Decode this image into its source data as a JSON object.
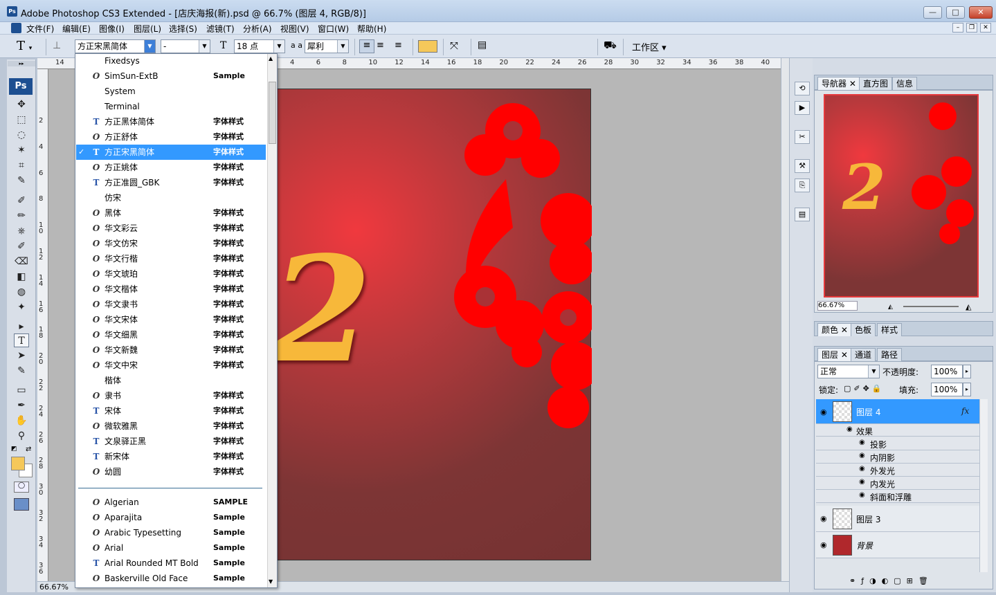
{
  "window": {
    "title": "Adobe Photoshop CS3 Extended - [店庆海报(新).psd @ 66.7% (图层 4, RGB/8)]",
    "min_glyph": "—",
    "max_glyph": "□",
    "close_glyph": "✕"
  },
  "menu": [
    "文件(F)",
    "编辑(E)",
    "图像(I)",
    "图层(L)",
    "选择(S)",
    "滤镜(T)",
    "分析(A)",
    "视图(V)",
    "窗口(W)",
    "帮助(H)"
  ],
  "options": {
    "font_family": "方正宋黑简体",
    "font_style": "-",
    "font_size": "18 点",
    "antialias_label": "a a",
    "antialias": "犀利",
    "workspace": "工作区",
    "text_color": "#f5c85a"
  },
  "font_list": {
    "items": [
      {
        "icon": "",
        "name": "Fixedsys",
        "sample": ""
      },
      {
        "icon": "O",
        "name": "SimSun-ExtB",
        "sample": "Sample"
      },
      {
        "icon": "",
        "name": "System",
        "sample": ""
      },
      {
        "icon": "",
        "name": "Terminal",
        "sample": ""
      },
      {
        "icon": "TT",
        "name": "方正黑体简体",
        "sample": "字体样式"
      },
      {
        "icon": "O",
        "name": "方正舒体",
        "sample": "字体样式"
      },
      {
        "icon": "TT",
        "name": "方正宋黑简体",
        "sample": "字体样式",
        "selected": true
      },
      {
        "icon": "O",
        "name": "方正姚体",
        "sample": "字体样式"
      },
      {
        "icon": "TT",
        "name": "方正准圆_GBK",
        "sample": "字体样式"
      },
      {
        "icon": "",
        "name": "仿宋",
        "sample": ""
      },
      {
        "icon": "O",
        "name": "黑体",
        "sample": "字体样式"
      },
      {
        "icon": "O",
        "name": "华文彩云",
        "sample": "字体样式"
      },
      {
        "icon": "O",
        "name": "华文仿宋",
        "sample": "字体样式"
      },
      {
        "icon": "O",
        "name": "华文行楷",
        "sample": "字体样式"
      },
      {
        "icon": "O",
        "name": "华文琥珀",
        "sample": "字体样式"
      },
      {
        "icon": "O",
        "name": "华文楷体",
        "sample": "字体样式"
      },
      {
        "icon": "O",
        "name": "华文隶书",
        "sample": "字体样式"
      },
      {
        "icon": "O",
        "name": "华文宋体",
        "sample": "字体样式"
      },
      {
        "icon": "O",
        "name": "华文细黑",
        "sample": "字体样式"
      },
      {
        "icon": "O",
        "name": "华文新魏",
        "sample": "字体样式"
      },
      {
        "icon": "O",
        "name": "华文中宋",
        "sample": "字体样式"
      },
      {
        "icon": "",
        "name": "楷体",
        "sample": ""
      },
      {
        "icon": "O",
        "name": "隶书",
        "sample": "字体样式"
      },
      {
        "icon": "TT",
        "name": "宋体",
        "sample": "字体样式"
      },
      {
        "icon": "O",
        "name": "微软雅黑",
        "sample": "字体样式"
      },
      {
        "icon": "TT",
        "name": "文泉驿正黑",
        "sample": "字体样式"
      },
      {
        "icon": "TT",
        "name": "新宋体",
        "sample": "字体样式"
      },
      {
        "icon": "O",
        "name": "幼圆",
        "sample": "字体样式"
      }
    ],
    "items2": [
      {
        "icon": "O",
        "name": "Algerian",
        "sample": "SAMPLE"
      },
      {
        "icon": "O",
        "name": "Aparajita",
        "sample": "Sample"
      },
      {
        "icon": "O",
        "name": "Arabic Typesetting",
        "sample": "Sample"
      },
      {
        "icon": "O",
        "name": "Arial",
        "sample": "Sample"
      },
      {
        "icon": "TT",
        "name": "Arial Rounded MT Bold",
        "sample": "Sample"
      },
      {
        "icon": "O",
        "name": "Baskerville Old Face",
        "sample": "Sample"
      }
    ]
  },
  "ruler_top": [
    "14",
    "4",
    "6",
    "8",
    "10",
    "12",
    "14",
    "16",
    "18",
    "20",
    "22",
    "24",
    "26",
    "28",
    "30",
    "32",
    "34",
    "36",
    "38",
    "40"
  ],
  "ruler_left": [
    "2",
    "4",
    "6",
    "8",
    "10",
    "12",
    "14",
    "16",
    "18",
    "20",
    "22",
    "24",
    "26",
    "28",
    "30",
    "32",
    "34",
    "36"
  ],
  "canvas": {
    "numeral": "2"
  },
  "status": {
    "zoom": "66.67%"
  },
  "navigator": {
    "tabs": [
      "导航器",
      "直方图",
      "信息"
    ],
    "zoom": "66.67%"
  },
  "color_panel": {
    "tabs": [
      "颜色",
      "色板",
      "样式"
    ]
  },
  "layers_panel": {
    "tabs": [
      "图层",
      "通道",
      "路径"
    ],
    "blend_mode": "正常",
    "opacity_label": "不透明度:",
    "opacity": "100%",
    "lock_label": "锁定:",
    "fill_label": "填充:",
    "fill": "100%",
    "layers": [
      {
        "name": "图层 4",
        "selected": true
      },
      {
        "name": "图层 3",
        "selected": false
      },
      {
        "name": "背景",
        "selected": false
      }
    ],
    "effects_label": "效果",
    "effects": [
      "投影",
      "内阴影",
      "外发光",
      "内发光",
      "斜面和浮雕"
    ],
    "fx": "fx"
  },
  "tools": [
    "✥",
    "⬚",
    "◌",
    "✶",
    "⌗",
    "✎",
    "✐",
    "✏",
    "⎈",
    "✐",
    "⌫",
    "◧",
    "◍",
    "✦",
    "▸",
    "T",
    "➤",
    "✎",
    "▭",
    "✒",
    "✋",
    "⚲"
  ]
}
